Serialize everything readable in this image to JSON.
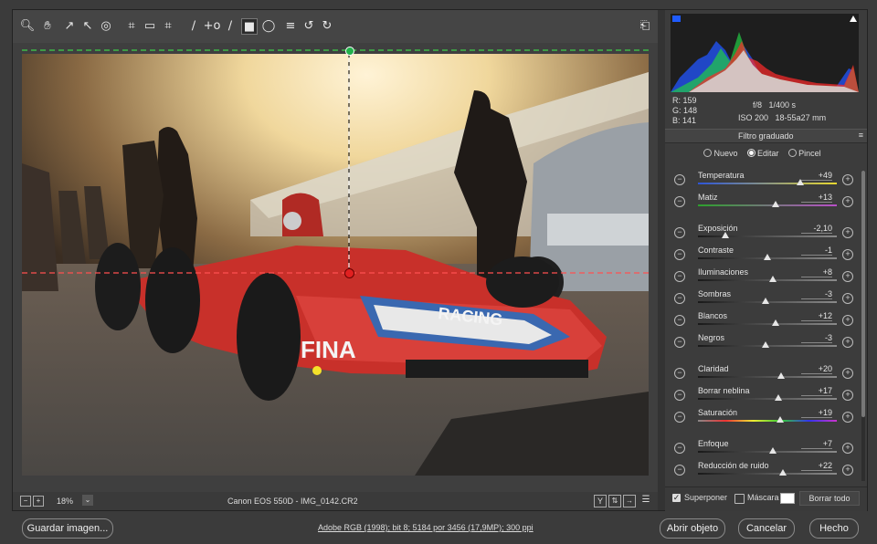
{
  "toolbar": {
    "tools": [
      "zoom-icon",
      "hand-icon",
      "white-balance-icon",
      "color-sampler-icon",
      "target-adjust-icon",
      "crop-icon",
      "straighten-icon",
      "transform-icon",
      "spot-removal-icon",
      "red-eye-icon",
      "adjustment-brush-icon",
      "graduated-filter-icon",
      "radial-filter-icon",
      "presets-icon",
      "rotate-left-icon",
      "rotate-right-icon"
    ],
    "fullscreen_icon": "fullscreen-icon"
  },
  "status": {
    "zoom": "18%",
    "camera_file": "Canon EOS 550D  -  IMG_0142.CR2"
  },
  "info": {
    "r_label": "R:",
    "r": "159",
    "g_label": "G:",
    "g": "148",
    "b_label": "B:",
    "b": "141",
    "aperture": "f/8",
    "shutter": "1/400 s",
    "iso": "ISO 200",
    "lens": "18-55a27 mm"
  },
  "panel": {
    "title": "Filtro graduado",
    "modes": [
      "Nuevo",
      "Editar",
      "Pincel"
    ],
    "selected_mode": "Editar"
  },
  "controls": [
    {
      "label": "Temperatura",
      "value": "+49",
      "pos": 0.74,
      "track": "temp"
    },
    {
      "label": "Matiz",
      "value": "+13",
      "pos": 0.56,
      "track": "tint"
    },
    {
      "label": "Exposición",
      "value": "-2,10",
      "pos": 0.2,
      "track": "grey"
    },
    {
      "label": "Contraste",
      "value": "-1",
      "pos": 0.5,
      "track": "grey"
    },
    {
      "label": "Iluminaciones",
      "value": "+8",
      "pos": 0.54,
      "track": "grey"
    },
    {
      "label": "Sombras",
      "value": "-3",
      "pos": 0.49,
      "track": "grey"
    },
    {
      "label": "Blancos",
      "value": "+12",
      "pos": 0.56,
      "track": "grey"
    },
    {
      "label": "Negros",
      "value": "-3",
      "pos": 0.49,
      "track": "grey"
    },
    {
      "label": "Claridad",
      "value": "+20",
      "pos": 0.6,
      "track": "grey"
    },
    {
      "label": "Borrar neblina",
      "value": "+17",
      "pos": 0.58,
      "track": "grey"
    },
    {
      "label": "Saturación",
      "value": "+19",
      "pos": 0.59,
      "track": "sat"
    },
    {
      "label": "Enfoque",
      "value": "+7",
      "pos": 0.54,
      "track": "grey"
    },
    {
      "label": "Reducción de ruido",
      "value": "+22",
      "pos": 0.61,
      "track": "grey"
    }
  ],
  "panel_footer": {
    "overlay_label": "Superponer",
    "overlay_checked": true,
    "mask_label": "Máscara",
    "mask_checked": false,
    "clear_all": "Borrar todo"
  },
  "footer": {
    "save": "Guardar imagen...",
    "workflow": "Adobe RGB (1998); bit 8; 5184 por 3456 (17,9MP); 300 ppi",
    "open": "Abrir objeto",
    "cancel": "Cancelar",
    "done": "Hecho"
  },
  "colors": {
    "accent": "#2f7bd9",
    "pin_red": "#e02020",
    "pin_green": "#22b14c",
    "car_red": "#c8302a"
  }
}
